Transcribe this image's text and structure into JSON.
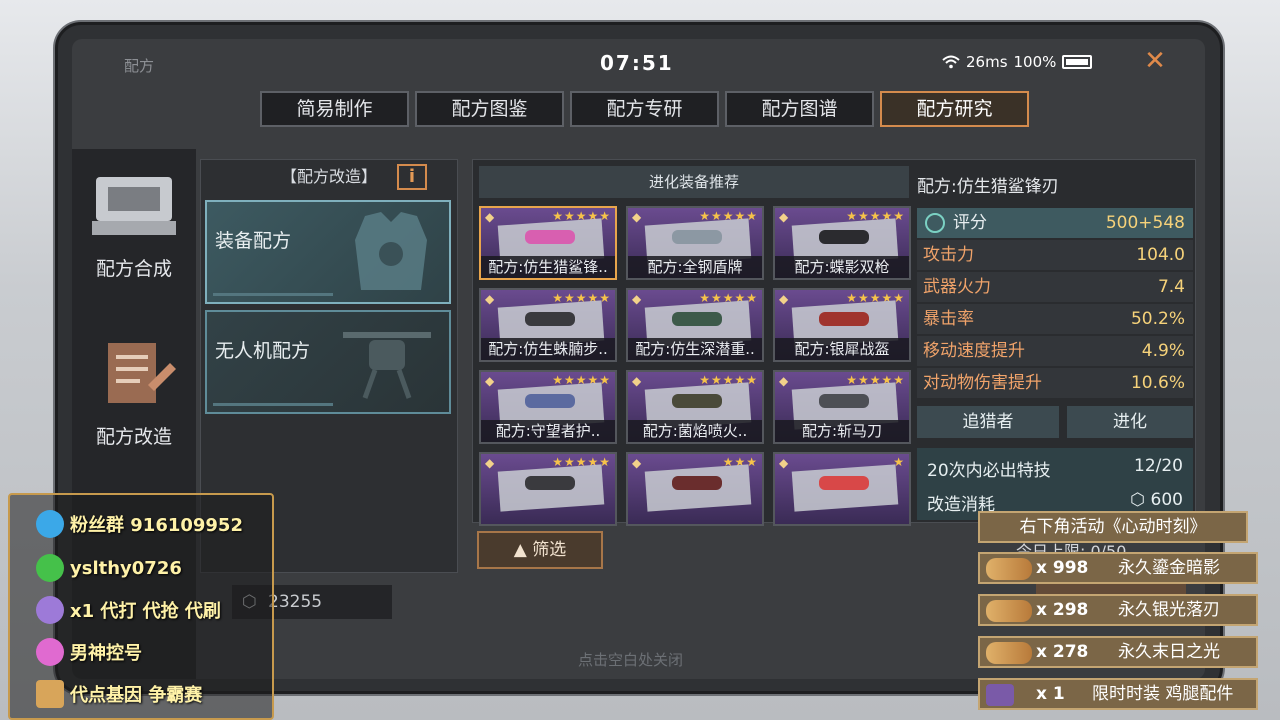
{
  "status": {
    "clock": "07:51",
    "ping": "26ms",
    "battery": "100%"
  },
  "screen_title": "配方",
  "tabs": [
    {
      "label": "简易制作"
    },
    {
      "label": "配方图鉴"
    },
    {
      "label": "配方专研"
    },
    {
      "label": "配方图谱"
    },
    {
      "label": "配方研究",
      "active": true
    }
  ],
  "leftnav": [
    {
      "label": "配方合成",
      "icon": "formula-synthesis-icon"
    },
    {
      "label": "配方改造",
      "icon": "formula-modify-icon"
    }
  ],
  "formula_panel": {
    "header": "【配方改造】",
    "info_badge": "i",
    "cards": [
      {
        "label": "装备配方",
        "selected": true
      },
      {
        "label": "无人机配方"
      }
    ]
  },
  "grid": {
    "header": "进化装备推荐",
    "cards": [
      {
        "name": "配方:仿生猎鲨锋..",
        "stars": 5,
        "color": "#d85fb0",
        "selected": true
      },
      {
        "name": "配方:全钢盾牌",
        "stars": 5,
        "color": "#8c98a3"
      },
      {
        "name": "配方:蝶影双枪",
        "stars": 5,
        "color": "#2b2b2f"
      },
      {
        "name": "配方:仿生蛛腩步..",
        "stars": 5,
        "color": "#3a3a3e"
      },
      {
        "name": "配方:仿生深潜重..",
        "stars": 5,
        "color": "#3d5a4a"
      },
      {
        "name": "配方:银犀战盔",
        "stars": 5,
        "color": "#a0342e"
      },
      {
        "name": "配方:守望者护..",
        "stars": 5,
        "color": "#5b6aa0"
      },
      {
        "name": "配方:菌焰喷火..",
        "stars": 5,
        "color": "#4a4a3a"
      },
      {
        "name": "配方:斩马刀",
        "stars": 5,
        "color": "#4d4f55"
      },
      {
        "name": "",
        "stars": 5,
        "color": "#3a3a3e"
      },
      {
        "name": "",
        "stars": 3,
        "color": "#6a2d2d"
      },
      {
        "name": "",
        "stars": 1,
        "color": "#d84848"
      }
    ]
  },
  "detail": {
    "title": "配方:仿生猎鲨锋刃",
    "stats": [
      {
        "k": "评分",
        "v": "500+548",
        "score": true
      },
      {
        "k": "攻击力",
        "v": "104.0"
      },
      {
        "k": "武器火力",
        "v": "7.4"
      },
      {
        "k": "暴击率",
        "v": "50.2%"
      },
      {
        "k": "移动速度提升",
        "v": "4.9%"
      },
      {
        "k": "对动物伤害提升",
        "v": "10.6%"
      }
    ],
    "tag_left": "追猎者",
    "tag_right": "进化",
    "guarantee_label": "20次内必出特技",
    "guarantee_value": "12/20",
    "cost_label": "改造消耗",
    "cost_value": "600"
  },
  "filter_label": "筛选",
  "money": "23255",
  "hint": "点击空白处关闭",
  "overlay": [
    {
      "icon": "qq-icon",
      "text": "粉丝群 916109952",
      "color": "#3ba8e8"
    },
    {
      "icon": "wechat-icon",
      "text": "yslthy0726",
      "color": "#45c14a"
    },
    {
      "icon": "rocket-icon",
      "text": "x1 代打 代抢 代刷",
      "color": "#9d7ad8"
    },
    {
      "icon": "rocket-icon-2",
      "text": "男神控号",
      "color": "#e06ad0"
    },
    {
      "icon": "gift-icon",
      "text": "代点基因 争霸赛",
      "color": "#d8a55a"
    }
  ],
  "event": {
    "title": "右下角活动《心动时刻》",
    "behind_text": "今日上限: 0/50",
    "rows": [
      {
        "count": "x 998",
        "name": "永久鎏金暗影"
      },
      {
        "count": "x 298",
        "name": "永久银光落刃"
      },
      {
        "count": "x 278",
        "name": "永久末日之光"
      },
      {
        "count": "x 1",
        "name": "限时时装 鸡腿配件"
      }
    ]
  }
}
